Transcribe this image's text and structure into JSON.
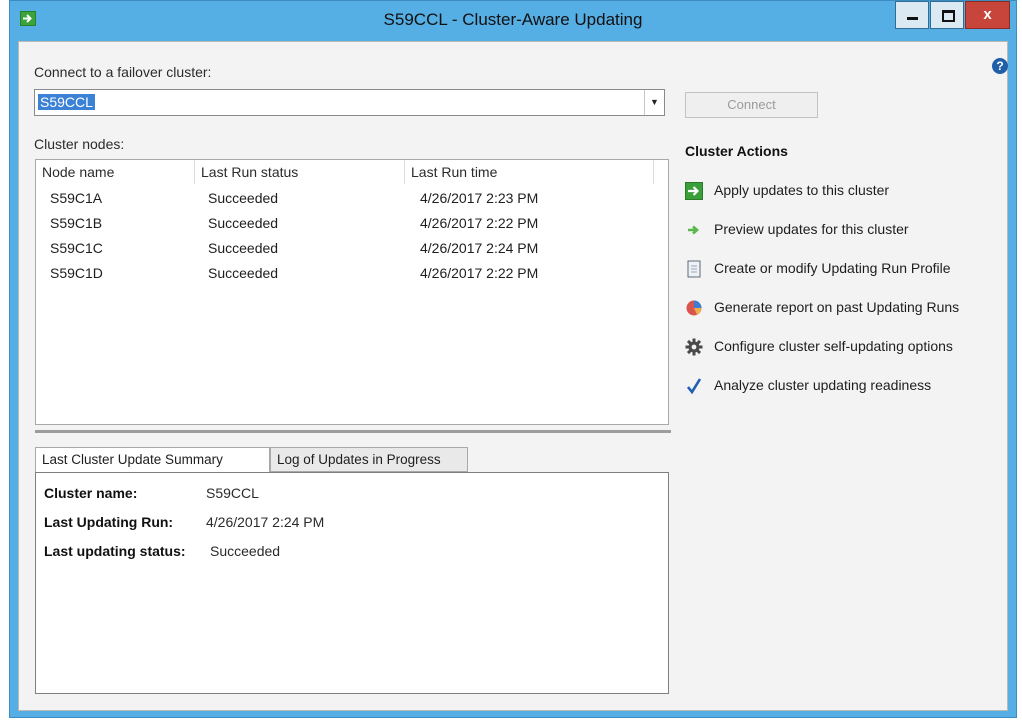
{
  "window": {
    "title": "S59CCL - Cluster-Aware Updating",
    "close_glyph": "x"
  },
  "connect": {
    "label": "Connect to a failover cluster:",
    "selected_cluster": "S59CCL",
    "button_label": "Connect",
    "help_glyph": "?"
  },
  "nodes": {
    "label": "Cluster nodes:",
    "columns": [
      "Node name",
      "Last Run status",
      "Last Run time"
    ],
    "rows": [
      {
        "name": "S59C1A",
        "status": "Succeeded",
        "time": "4/26/2017 2:23 PM"
      },
      {
        "name": "S59C1B",
        "status": "Succeeded",
        "time": "4/26/2017 2:22 PM"
      },
      {
        "name": "S59C1C",
        "status": "Succeeded",
        "time": "4/26/2017 2:24 PM"
      },
      {
        "name": "S59C1D",
        "status": "Succeeded",
        "time": "4/26/2017 2:22 PM"
      }
    ]
  },
  "tabs": [
    "Last Cluster Update Summary",
    "Log of Updates in Progress"
  ],
  "summary": {
    "cluster_name_label": "Cluster name:",
    "cluster_name": "S59CCL",
    "last_run_label": "Last Updating Run:",
    "last_run": "4/26/2017 2:24 PM",
    "last_status_label": "Last updating status:",
    "last_status": "Succeeded"
  },
  "actions": {
    "title": "Cluster Actions",
    "items": [
      {
        "label": "Apply updates to this cluster",
        "icon": "apply-updates-icon"
      },
      {
        "label": "Preview updates for this cluster",
        "icon": "preview-arrow-icon"
      },
      {
        "label": "Create or modify Updating Run Profile",
        "icon": "profile-document-icon"
      },
      {
        "label": "Generate report on past Updating Runs",
        "icon": "report-chart-icon"
      },
      {
        "label": "Configure cluster self-updating options",
        "icon": "gear-icon"
      },
      {
        "label": "Analyze cluster updating readiness",
        "icon": "checkmark-icon"
      }
    ]
  },
  "colors": {
    "titlebar": "#55aee4",
    "selection": "#3b82d6",
    "close_button": "#c7453a"
  }
}
